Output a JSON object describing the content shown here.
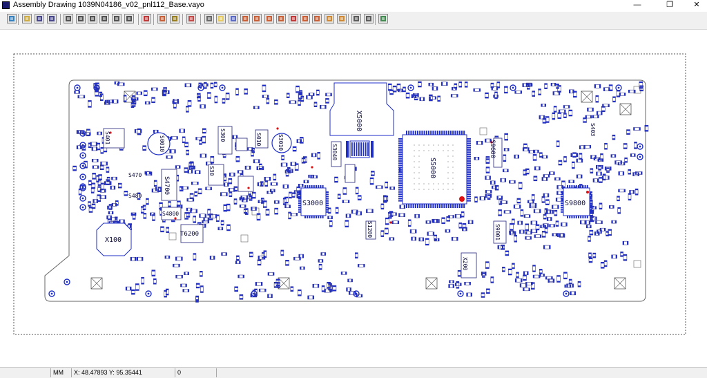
{
  "window": {
    "title": "Assembly Drawing 1039N04186_v02_pnl112_Base.vayo",
    "minimize_glyph": "—",
    "maximize_glyph": "❐",
    "close_glyph": "✕"
  },
  "toolbar": {
    "buttons": [
      {
        "name": "refresh-icon"
      },
      {
        "name": "open-folder-icon"
      },
      {
        "name": "save-icon"
      },
      {
        "name": "save-all-icon"
      },
      {
        "name": "zoom-window-icon"
      },
      {
        "name": "zoom-fit-icon"
      },
      {
        "name": "zoom-in-icon"
      },
      {
        "name": "zoom-out-icon"
      },
      {
        "name": "pan-icon"
      },
      {
        "name": "rotate-icon"
      },
      {
        "name": "text-list-icon"
      },
      {
        "name": "layer-icon"
      },
      {
        "name": "find-icon"
      },
      {
        "name": "check-icon"
      },
      {
        "name": "eraser-icon"
      },
      {
        "name": "folder-highlight-icon"
      },
      {
        "name": "component-a-icon"
      },
      {
        "name": "component-b-icon"
      },
      {
        "name": "component-c-icon"
      },
      {
        "name": "component-d-icon"
      },
      {
        "name": "component-e-icon"
      },
      {
        "name": "text-t-icon"
      },
      {
        "name": "component-f-icon"
      },
      {
        "name": "component-g-icon"
      },
      {
        "name": "component-h-icon"
      },
      {
        "name": "component-i-icon"
      },
      {
        "name": "print-icon"
      },
      {
        "name": "report-icon"
      },
      {
        "name": "exit-icon"
      }
    ]
  },
  "board": {
    "labels": {
      "x5000": "X5000",
      "s5000": "S5000",
      "s3000": "S3000",
      "s9800": "S9800",
      "s9600": "S9600",
      "x100": "X100",
      "t6200": "T6200",
      "s4700": "S4700",
      "s4800": "S4800",
      "s9001": "S9001",
      "x200": "X200",
      "s1200": "S1200",
      "s3040": "S3040",
      "s3010": "S3010",
      "s300": "S300",
      "s010": "S010",
      "s0010": "S0010",
      "s470": "S470",
      "s480": "S480",
      "s401": "S401",
      "s30": "S30",
      "s403": "S403"
    }
  },
  "status": {
    "units": "MM",
    "coords": "X: 48.47893 Y: 95.35441",
    "count": "0"
  }
}
